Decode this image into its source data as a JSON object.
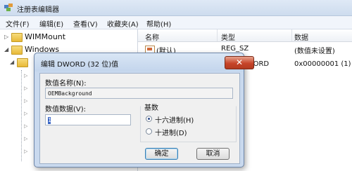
{
  "window": {
    "title": "注册表编辑器",
    "icon": "registry-editor-icon"
  },
  "menu": {
    "items": [
      {
        "label": "文件(F)"
      },
      {
        "label": "编辑(E)"
      },
      {
        "label": "查看(V)"
      },
      {
        "label": "收藏夹(A)"
      },
      {
        "label": "帮助(H)"
      }
    ]
  },
  "tree": {
    "items": [
      {
        "label": "WIMMount",
        "expander": "▷"
      },
      {
        "label": "Windows",
        "expander": "◢"
      }
    ]
  },
  "list": {
    "headers": {
      "name": "名称",
      "type": "类型",
      "data": "数据"
    },
    "rows": [
      {
        "name": "(默认)",
        "type": "REG_SZ",
        "data": "(数值未设置)"
      },
      {
        "name": "",
        "type": "DWORD",
        "data": "0x00000001 (1)"
      }
    ]
  },
  "dialog": {
    "title": "编辑 DWORD (32 位)值",
    "close_label": "✕",
    "value_name_label": "数值名称(N):",
    "value_name": "OEMBackground",
    "value_data_label": "数值数据(V):",
    "value_data": "1",
    "base_label": "基数",
    "base_options": [
      {
        "label": "十六进制(H)",
        "checked": true
      },
      {
        "label": "十进制(D)",
        "checked": false
      }
    ],
    "ok_label": "确定",
    "cancel_label": "取消"
  },
  "colors": {
    "close_button": "#c7452a",
    "dialog_frame": "#c9d9ee",
    "selection_caret": "#3a66c5"
  }
}
